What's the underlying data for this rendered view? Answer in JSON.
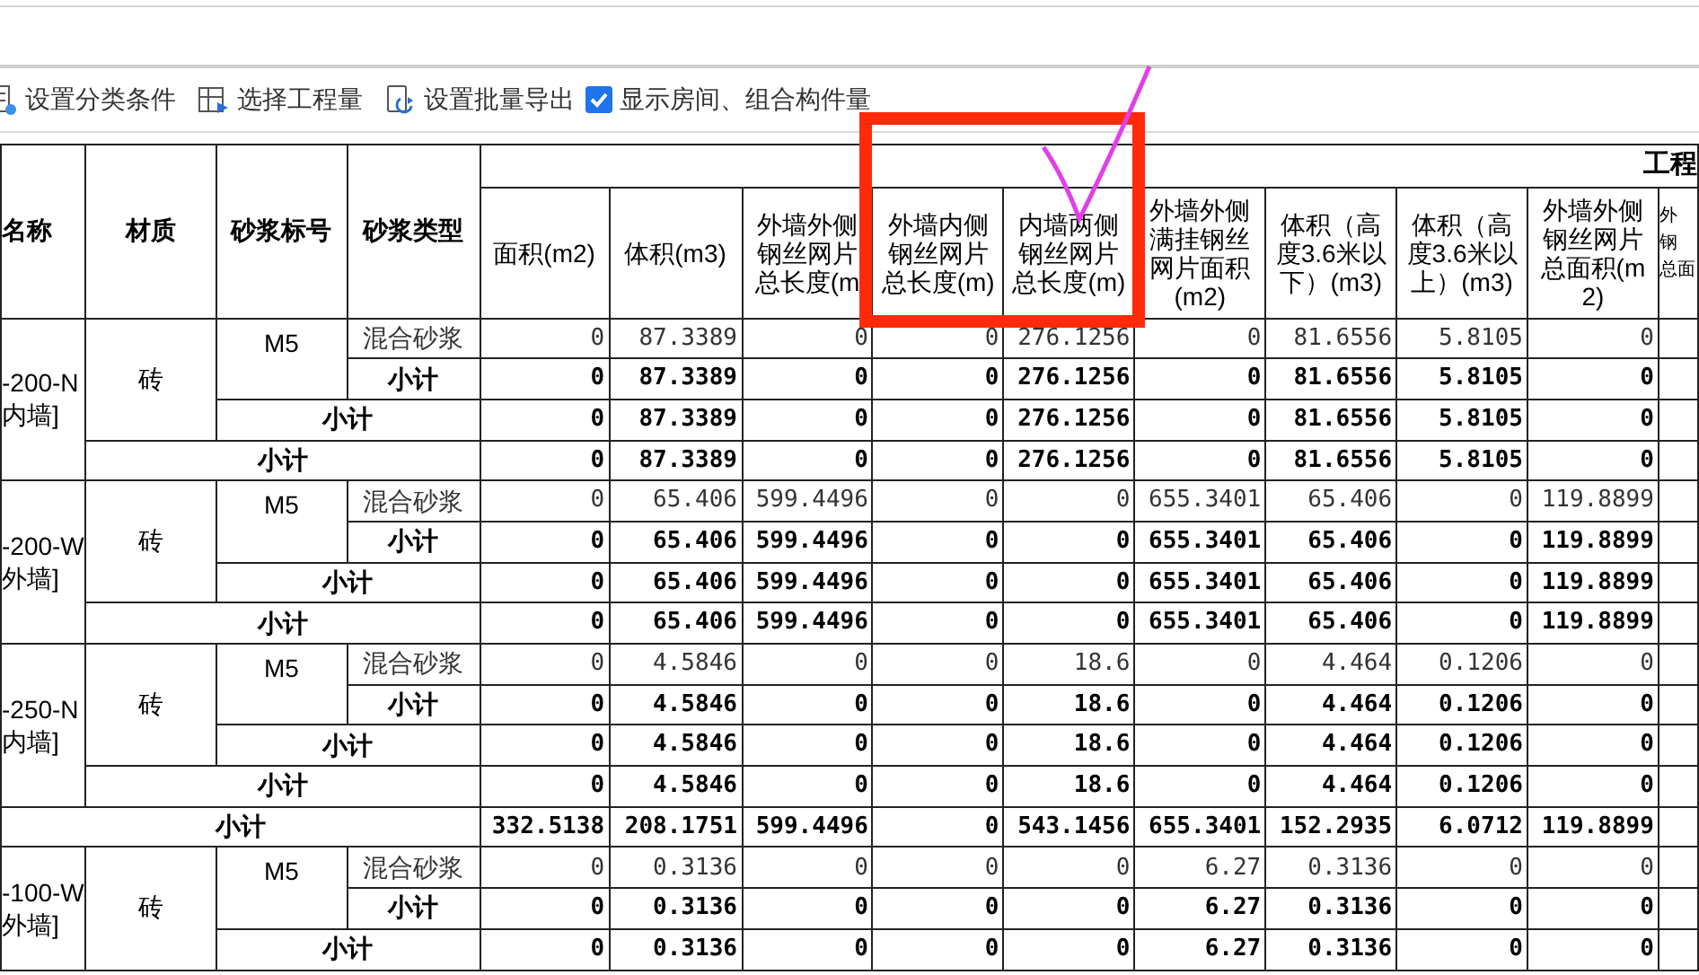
{
  "toolbar": {
    "items": [
      {
        "kind": "button",
        "label": "设置分类条件"
      },
      {
        "kind": "button",
        "label": "选择工程量"
      },
      {
        "kind": "button",
        "label": "设置批量导出"
      },
      {
        "kind": "checkbox",
        "label": "显示房间、组合构件量",
        "checked": true
      }
    ]
  },
  "table": {
    "group_header": "工程",
    "key_columns": [
      "名称",
      "材质",
      "砂浆标号",
      "砂浆类型"
    ],
    "value_columns": [
      "面积(m2)",
      "体积(m3)",
      "外墙外侧钢丝网片总长度(m",
      "外墙内侧钢丝网片总长度(m)",
      "内墙两侧钢丝网片总长度(m)",
      "外墙外侧满挂钢丝网片面积(m2)",
      "体积（高度3.6米以下）(m3)",
      "体积（高度3.6米以上）(m3)",
      "外墙外侧钢丝网片总面积(m2)"
    ],
    "column_14": [
      "外",
      "钢",
      "总面"
    ],
    "body": [
      {
        "kind": "group",
        "name": [
          "-200-N",
          "内墙]"
        ],
        "material": "砖",
        "grade": "M5",
        "rows": [
          {
            "kind": "detail",
            "label": "混合砂浆",
            "values": [
              "0",
              "87.3389",
              "0",
              "0",
              "276.1256",
              "0",
              "81.6556",
              "5.8105",
              "0"
            ]
          },
          {
            "kind": "grade_subtotal",
            "label": "小计",
            "values": [
              "0",
              "87.3389",
              "0",
              "0",
              "276.1256",
              "0",
              "81.6556",
              "5.8105",
              "0"
            ]
          },
          {
            "kind": "material_subtotal",
            "label": "小计",
            "values": [
              "0",
              "87.3389",
              "0",
              "0",
              "276.1256",
              "0",
              "81.6556",
              "5.8105",
              "0"
            ]
          },
          {
            "kind": "name_subtotal",
            "label": "小计",
            "values": [
              "0",
              "87.3389",
              "0",
              "0",
              "276.1256",
              "0",
              "81.6556",
              "5.8105",
              "0"
            ]
          }
        ]
      },
      {
        "kind": "group",
        "name": [
          "-200-W",
          "外墙]"
        ],
        "material": "砖",
        "grade": "M5",
        "rows": [
          {
            "kind": "detail",
            "label": "混合砂浆",
            "values": [
              "0",
              "65.406",
              "599.4496",
              "0",
              "0",
              "655.3401",
              "65.406",
              "0",
              "119.8899"
            ]
          },
          {
            "kind": "grade_subtotal",
            "label": "小计",
            "values": [
              "0",
              "65.406",
              "599.4496",
              "0",
              "0",
              "655.3401",
              "65.406",
              "0",
              "119.8899"
            ]
          },
          {
            "kind": "material_subtotal",
            "label": "小计",
            "values": [
              "0",
              "65.406",
              "599.4496",
              "0",
              "0",
              "655.3401",
              "65.406",
              "0",
              "119.8899"
            ]
          },
          {
            "kind": "name_subtotal",
            "label": "小计",
            "values": [
              "0",
              "65.406",
              "599.4496",
              "0",
              "0",
              "655.3401",
              "65.406",
              "0",
              "119.8899"
            ]
          }
        ]
      },
      {
        "kind": "group",
        "name": [
          "-250-N",
          "内墙]"
        ],
        "material": "砖",
        "grade": "M5",
        "rows": [
          {
            "kind": "detail",
            "label": "混合砂浆",
            "values": [
              "0",
              "4.5846",
              "0",
              "0",
              "18.6",
              "0",
              "4.464",
              "0.1206",
              "0"
            ]
          },
          {
            "kind": "grade_subtotal",
            "label": "小计",
            "values": [
              "0",
              "4.5846",
              "0",
              "0",
              "18.6",
              "0",
              "4.464",
              "0.1206",
              "0"
            ]
          },
          {
            "kind": "material_subtotal",
            "label": "小计",
            "values": [
              "0",
              "4.5846",
              "0",
              "0",
              "18.6",
              "0",
              "4.464",
              "0.1206",
              "0"
            ]
          },
          {
            "kind": "name_subtotal",
            "label": "小计",
            "values": [
              "0",
              "4.5846",
              "0",
              "0",
              "18.6",
              "0",
              "4.464",
              "0.1206",
              "0"
            ]
          }
        ]
      },
      {
        "kind": "total",
        "label": "小计",
        "values": [
          "332.5138",
          "208.1751",
          "599.4496",
          "0",
          "543.1456",
          "655.3401",
          "152.2935",
          "6.0712",
          "119.8899"
        ]
      },
      {
        "kind": "group",
        "name": [
          "-100-W",
          "外墙]"
        ],
        "material": "砖",
        "grade": "M5",
        "rows": [
          {
            "kind": "detail",
            "label": "混合砂浆",
            "values": [
              "0",
              "0.3136",
              "0",
              "0",
              "0",
              "6.27",
              "0.3136",
              "0",
              "0"
            ]
          },
          {
            "kind": "grade_subtotal",
            "label": "小计",
            "values": [
              "0",
              "0.3136",
              "0",
              "0",
              "0",
              "6.27",
              "0.3136",
              "0",
              "0"
            ]
          },
          {
            "kind": "material_subtotal",
            "label": "小计",
            "values": [
              "0",
              "0.3136",
              "0",
              "0",
              "0",
              "6.27",
              "0.3136",
              "0",
              "0"
            ]
          }
        ]
      }
    ]
  }
}
